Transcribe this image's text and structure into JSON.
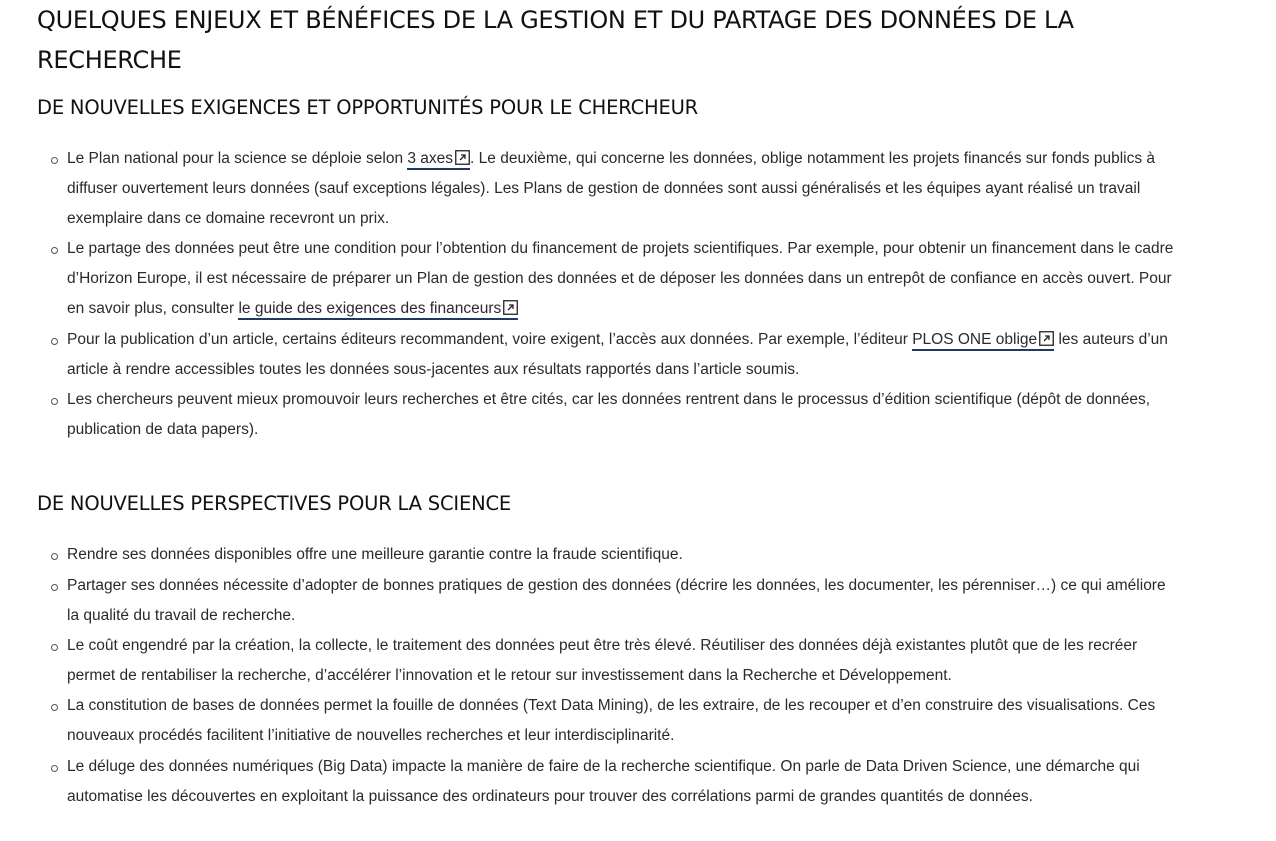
{
  "main_title": "QUELQUES ENJEUX ET BÉNÉFICES DE LA GESTION ET DU PARTAGE DES DONNÉES DE LA RECHERCHE",
  "section1": {
    "title": "DE NOUVELLES EXIGENCES ET OPPORTUNITÉS POUR LE CHERCHEUR",
    "item1": {
      "before": "Le Plan national pour la science se déploie selon ",
      "link": "3 axes",
      "after": ". Le deuxième, qui concerne les données, oblige notamment les projets financés sur fonds publics à diffuser ouvertement leurs données (sauf exceptions légales). Les Plans de gestion de données sont aussi généralisés et les équipes ayant réalisé un travail exemplaire dans ce domaine recevront un prix."
    },
    "item2": {
      "before": "Le partage des données peut être une condition pour l’obtention du financement de projets scientifiques. Par exemple, pour obtenir un financement dans le cadre d’Horizon Europe, il est nécessaire de préparer un Plan de gestion des données et de déposer les données dans un entrepôt de confiance en accès ouvert. Pour en savoir plus, consulter ",
      "link": "le guide des exigences des financeurs"
    },
    "item3": {
      "before": "Pour la publication d’un article, certains éditeurs recommandent, voire exigent, l’accès aux données. Par exemple, l’éditeur ",
      "link": "PLOS ONE oblige",
      "after": " les auteurs d’un article à rendre accessibles toutes les données sous-jacentes aux résultats rapportés dans l’article soumis."
    },
    "item4": {
      "text": "Les chercheurs peuvent mieux promouvoir leurs recherches et être cités, car les données rentrent dans le processus d’édition scientifique (dépôt de données, publication de data papers)."
    }
  },
  "section2": {
    "title": "DE NOUVELLES PERSPECTIVES POUR LA SCIENCE",
    "items": [
      "Rendre ses données disponibles offre une meilleure garantie contre la fraude scientifique.",
      "Partager ses données nécessite d’adopter de bonnes pratiques de gestion des données (décrire les données, les documenter, les pérenniser…) ce qui améliore la qualité du travail de recherche.",
      "Le coût engendré par la création, la collecte, le traitement des données peut être très élevé. Réutiliser des données déjà existantes plutôt que de les recréer permet de rentabiliser la recherche, d’accélérer l’innovation et le retour sur investissement dans la Recherche et Développement.",
      "La constitution de bases de données permet la fouille de données (Text Data Mining), de les extraire, de les recouper et d’en construire des visualisations. Ces nouveaux procédés facilitent l’initiative de nouvelles recherches et leur interdisciplinarité.",
      "Le déluge des données numériques (Big Data) impacte la manière de faire de la recherche scientifique. On parle de Data Driven Science, une démarche qui automatise les découvertes en exploitant la puissance des ordinateurs pour trouver des corrélations parmi de grandes quantités de données."
    ]
  },
  "icons": {
    "bullet": "hollow-circle-bullet",
    "external_link": "external-link-icon"
  },
  "colors": {
    "link_underline": "#1e3a5f",
    "text": "#2a2a2a",
    "heading": "#111111"
  }
}
